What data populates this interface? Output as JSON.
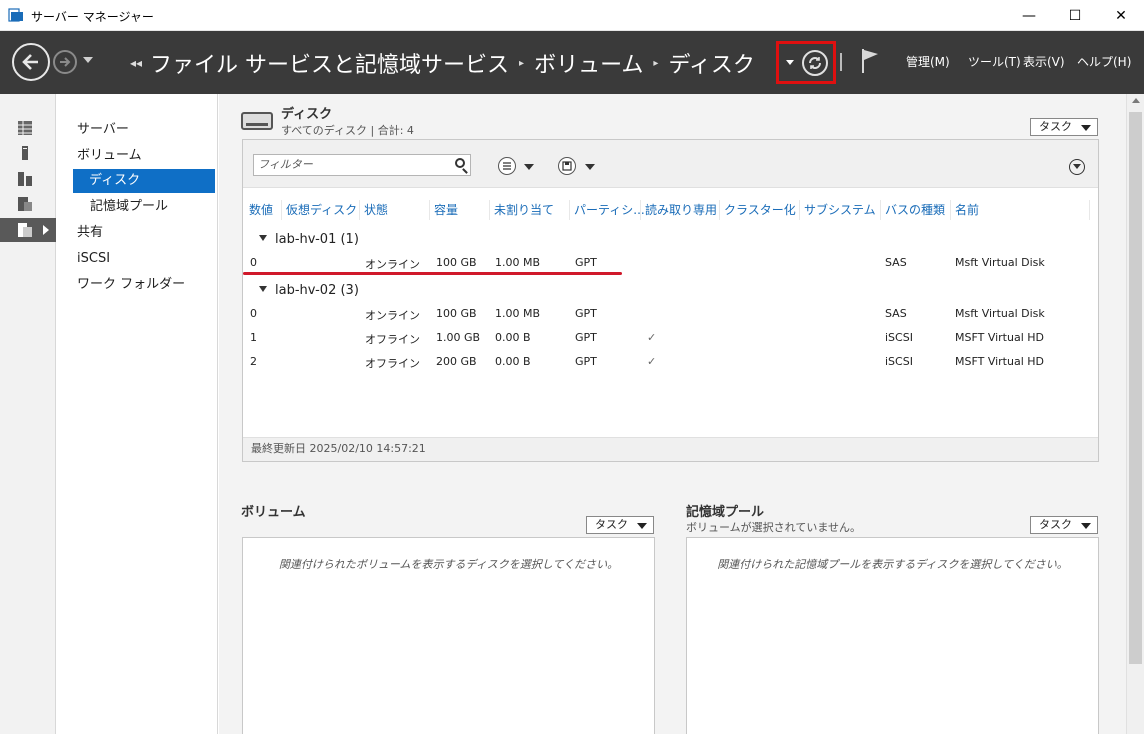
{
  "window": {
    "title": "サーバー マネージャー",
    "minimize": "—",
    "maximize": "☐",
    "close": "✕"
  },
  "header": {
    "breadcrumb": [
      "ファイル サービスと記憶域サービス",
      "ボリューム",
      "ディスク"
    ],
    "lead": "◂◂",
    "sep": "▸",
    "menus": [
      "管理(M)",
      "ツール(T)",
      "表示(V)",
      "ヘルプ(H)"
    ]
  },
  "nav": {
    "items": [
      "サーバー",
      "ボリューム",
      "ディスク",
      "記憶域プール",
      "共有",
      "iSCSI",
      "ワーク フォルダー"
    ]
  },
  "disks": {
    "title": "ディスク",
    "subtitle": "すべてのディスク | 合計: 4",
    "task_label": "タスク",
    "filter_placeholder": "フィルター",
    "columns": [
      "数値",
      "仮想ディスク",
      "状態",
      "容量",
      "未割り当て",
      "パーティシ...",
      "読み取り専用",
      "クラスター化",
      "サブシステム",
      "バスの種類",
      "名前"
    ],
    "groups": [
      {
        "name": "lab-hv-01 (1)",
        "rows": [
          {
            "num": "0",
            "vdisk": "",
            "status": "オンライン",
            "capacity": "100 GB",
            "unalloc": "1.00 MB",
            "partition": "GPT",
            "readonly": "",
            "cluster": "",
            "subsystem": "",
            "bus": "SAS",
            "name": "Msft Virtual Disk"
          }
        ]
      },
      {
        "name": "lab-hv-02 (3)",
        "rows": [
          {
            "num": "0",
            "vdisk": "",
            "status": "オンライン",
            "capacity": "100 GB",
            "unalloc": "1.00 MB",
            "partition": "GPT",
            "readonly": "",
            "cluster": "",
            "subsystem": "",
            "bus": "SAS",
            "name": "Msft Virtual Disk"
          },
          {
            "num": "1",
            "vdisk": "",
            "status": "オフライン",
            "capacity": "1.00 GB",
            "unalloc": "0.00 B",
            "partition": "GPT",
            "readonly": "✓",
            "cluster": "",
            "subsystem": "",
            "bus": "iSCSI",
            "name": "MSFT Virtual HD"
          },
          {
            "num": "2",
            "vdisk": "",
            "status": "オフライン",
            "capacity": "200 GB",
            "unalloc": "0.00 B",
            "partition": "GPT",
            "readonly": "✓",
            "cluster": "",
            "subsystem": "",
            "bus": "iSCSI",
            "name": "MSFT Virtual HD"
          }
        ]
      }
    ],
    "footer": "最終更新日 2025/02/10 14:57:21"
  },
  "volumes": {
    "title": "ボリューム",
    "task_label": "タスク",
    "empty": "関連付けられたボリュームを表示するディスクを選択してください。"
  },
  "pools": {
    "title": "記憶域プール",
    "subtitle": "ボリュームが選択されていません。",
    "task_label": "タスク",
    "empty": "関連付けられた記憶域プールを表示するディスクを選択してください。"
  },
  "colors": {
    "header_bg": "#3a3a3a",
    "selected": "#0f6fc6",
    "highlight": "#e01010",
    "link": "#1a6cb8"
  }
}
